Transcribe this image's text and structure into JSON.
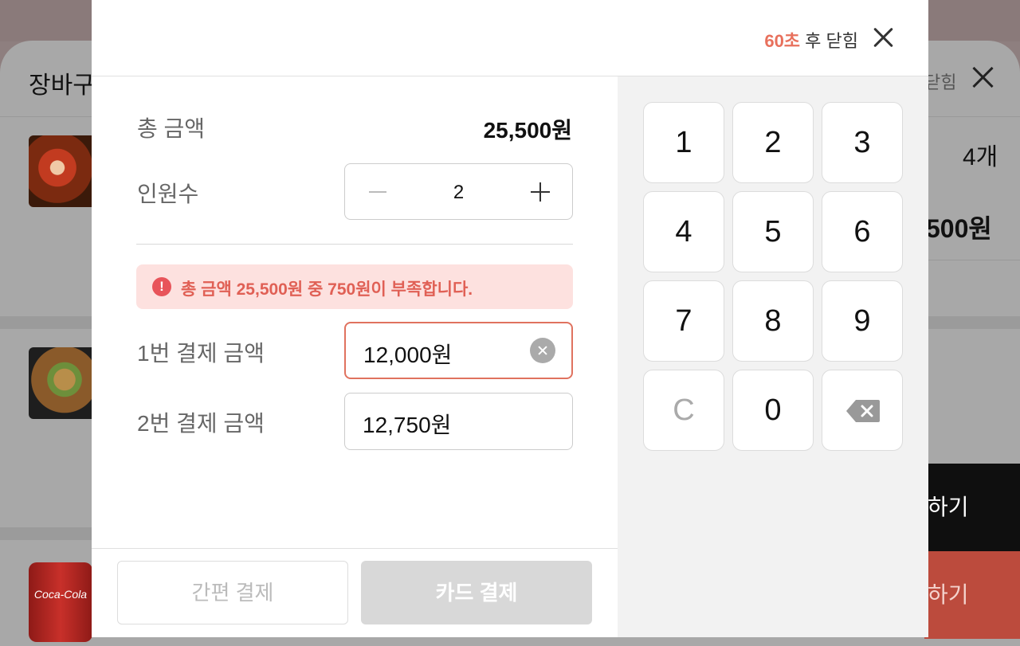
{
  "background": {
    "title": "장바구",
    "close_label": "닫힘",
    "quantity": "4개",
    "price": "500원",
    "food3_label": "Coca-Cola",
    "button1": "하기",
    "button2": "하기"
  },
  "modal": {
    "timer_seconds": "60초",
    "timer_suffix": " 후 닫힘",
    "total_label": "총 금액",
    "total_value": "25,500원",
    "people_label": "인원수",
    "people_count": "2",
    "alert_text": "총 금액 25,500원 중 750원이 부족합니다.",
    "alert_icon": "!",
    "payment1_label": "1번 결제 금액",
    "payment1_value": "12,000원",
    "payment2_label": "2번 결제 금액",
    "payment2_value": "12,750원",
    "easy_pay_label": "간편 결제",
    "card_pay_label": "카드 결제"
  },
  "keypad": {
    "keys": [
      "1",
      "2",
      "3",
      "4",
      "5",
      "6",
      "7",
      "8",
      "9",
      "C",
      "0"
    ]
  },
  "colors": {
    "accent": "#e8705c",
    "alert_bg": "#fde1df",
    "alert_text": "#e06055"
  }
}
